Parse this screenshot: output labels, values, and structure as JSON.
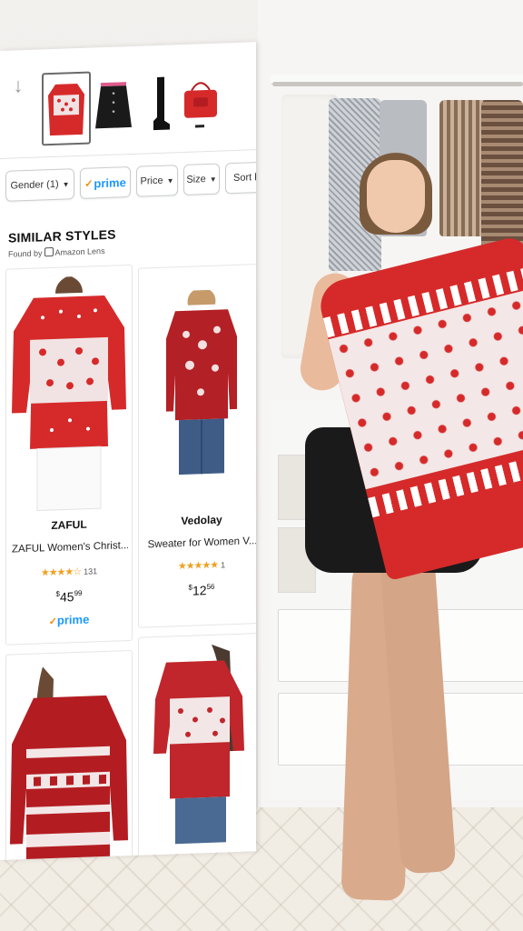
{
  "colors": {
    "prime_blue": "#1a98ff",
    "prime_check": "#f08c00",
    "star": "#f0a020",
    "sweater_red": "#d62a2a"
  },
  "thumbnails": [
    {
      "name": "red-white sweater thumbnail",
      "selected": true
    },
    {
      "name": "black skirt thumbnail",
      "selected": false
    },
    {
      "name": "black boot thumbnail",
      "selected": false
    },
    {
      "name": "red bag thumbnail",
      "selected": false
    }
  ],
  "filters": {
    "gender": "Gender (1)",
    "prime": "prime",
    "price": "Price",
    "size": "Size",
    "sort": "Sort by"
  },
  "similar": {
    "title": "SIMILAR STYLES",
    "found_by_prefix": "Found by",
    "found_by_source": "Amazon Lens"
  },
  "products": [
    {
      "brand": "ZAFUL",
      "title": "ZAFUL Women's Christ...",
      "stars": "★★★★☆",
      "reviews": "131",
      "price_symbol": "$",
      "price_whole": "45",
      "price_fraction": "99",
      "prime": "prime"
    },
    {
      "brand": "Vedolay",
      "title": "Sweater for Women V...",
      "stars": "★★★★★",
      "reviews": "1",
      "price_symbol": "$",
      "price_whole": "12",
      "price_fraction": "56"
    }
  ]
}
